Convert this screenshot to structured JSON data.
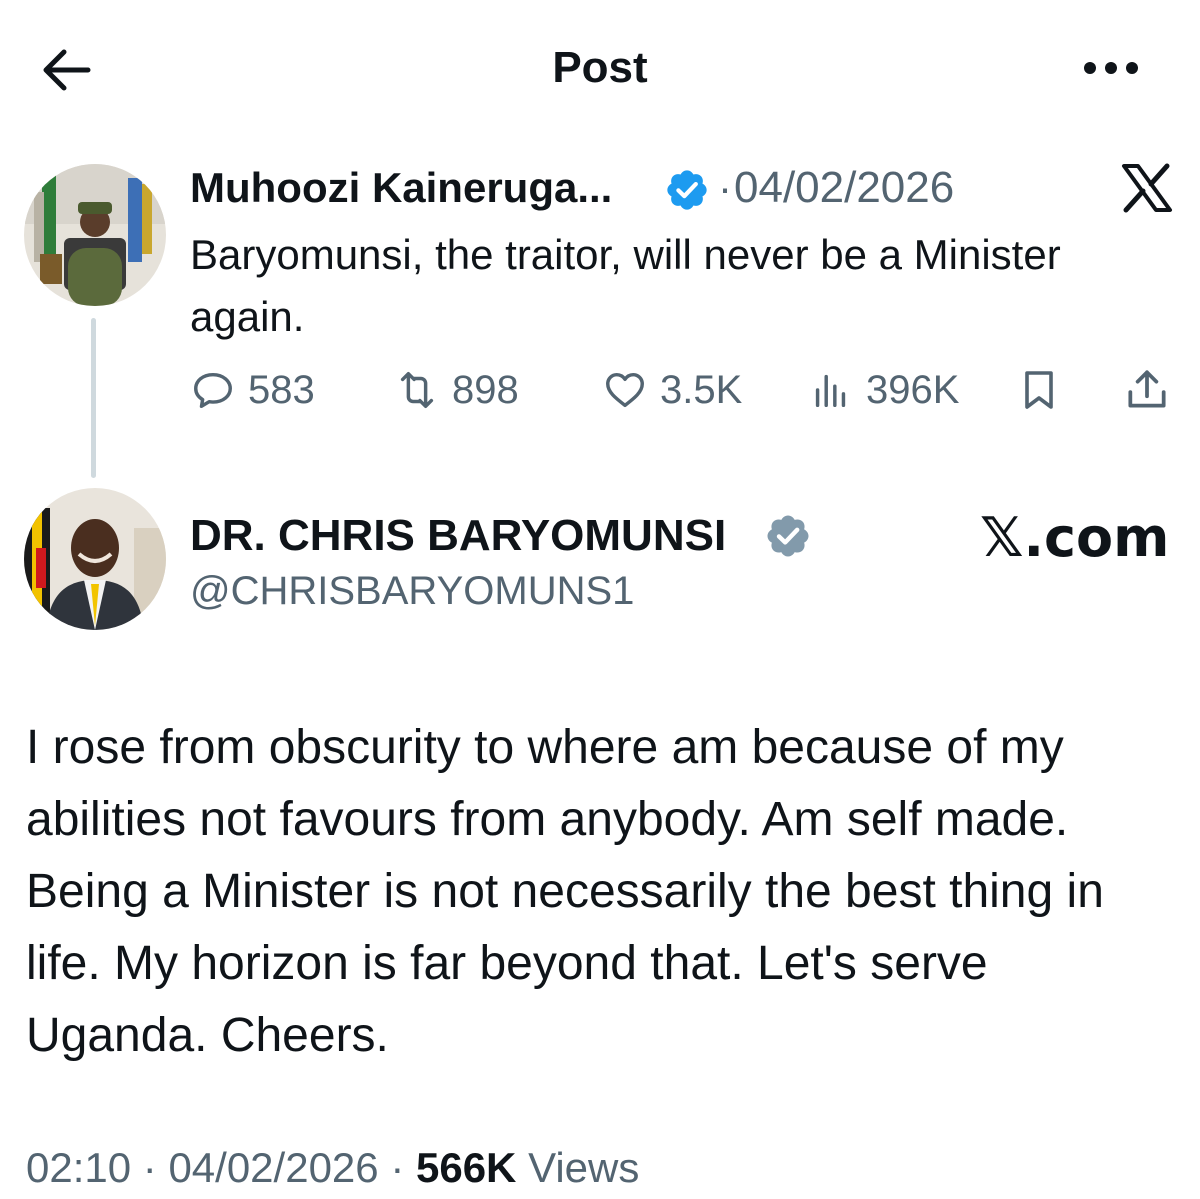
{
  "header": {
    "title": "Post",
    "back_icon": "arrow-left-icon",
    "more_icon": "more-dots-icon"
  },
  "quoted_post": {
    "author_name": "Muhoozi Kaineruga...",
    "date": "04/02/2026",
    "separator": "·",
    "text": "Baryomunsi, the traitor, will never be a Minister again.",
    "stats": {
      "replies": "583",
      "reposts": "898",
      "likes": "3.5K",
      "views": "396K"
    },
    "verified_color": "#1d9bf0"
  },
  "post": {
    "author_name": "DR. CHRIS BARYOMUNSI",
    "author_handle": "@CHRISBARYOMUNS1",
    "brand": "𝕏.com",
    "verified_color": "#829aab",
    "text": "I rose from obscurity to where am because of my abilities not favours from anybody. Am self made.  Being a Minister is not necessarily the best thing in life. My horizon is far beyond that. Let's serve Uganda. Cheers.",
    "time": "02:10",
    "date": "04/02/2026",
    "views_count": "566K",
    "views_label": "Views"
  }
}
